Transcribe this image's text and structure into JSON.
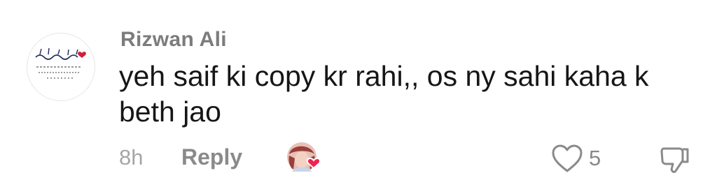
{
  "comment": {
    "username": "Rizwan Ali",
    "text_line_1": "yeh saif ki copy kr rahi,, os ny sahi kaha k",
    "text_line_2": "beth jao",
    "timestamp": "8h",
    "reply_label": "Reply",
    "like_count": "5",
    "avatar": {
      "icon": "calligraphy-avatar-icon",
      "accent_color": "#d0213a"
    },
    "creator_liked": {
      "icon": "creator-avatar-with-heart-icon",
      "heart_color": "#f0244f"
    },
    "like_icon": "heart-outline-icon",
    "dislike_icon": "thumbs-down-icon"
  }
}
